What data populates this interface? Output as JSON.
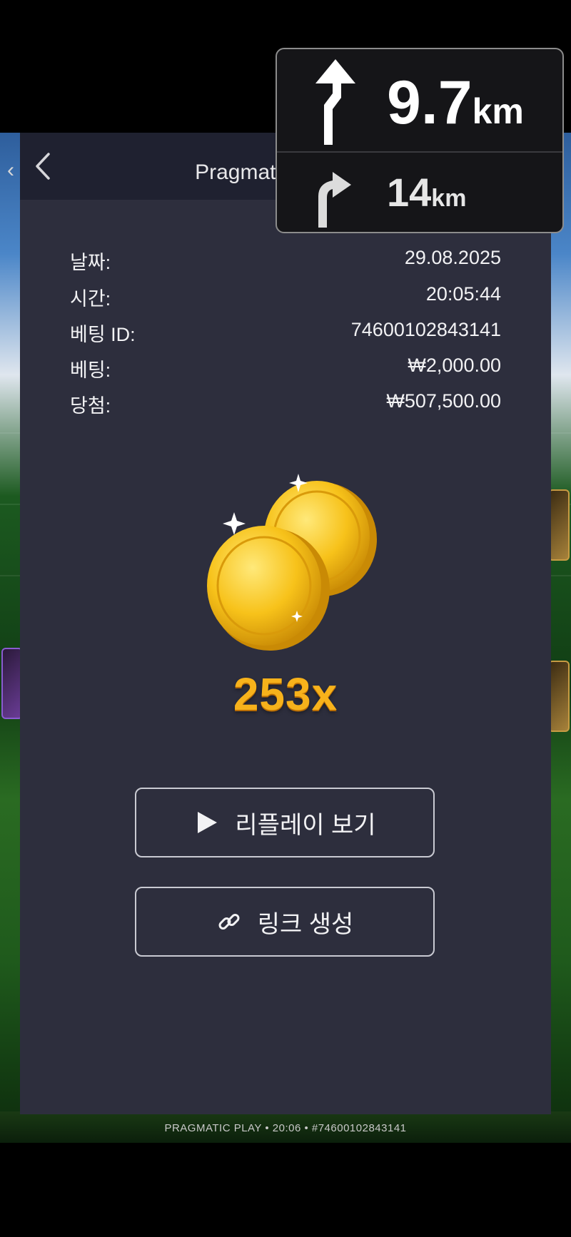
{
  "window": {
    "title": "Pragmatic 리플레이"
  },
  "details": [
    {
      "label": "날짜:",
      "value": "29.08.2025"
    },
    {
      "label": "시간:",
      "value": "20:05:44"
    },
    {
      "label": "베팅 ID:",
      "value": "74600102843141"
    },
    {
      "label": "베팅:",
      "value": "₩2,000.00"
    },
    {
      "label": "당첨:",
      "value": "₩507,500.00"
    }
  ],
  "multiplier": "253x",
  "buttons": {
    "watch_replay": "리플레이 보기",
    "create_link": "링크 생성"
  },
  "footer": "PRAGMATIC PLAY • 20:06 • #74600102843141",
  "navigation": {
    "primary_distance": "9.7",
    "primary_unit": "km",
    "secondary_distance": "14",
    "secondary_unit": "km",
    "primary_icon": "turn-left-then-straight-icon",
    "secondary_icon": "turn-right-icon"
  },
  "colors": {
    "panel": "#2d2e3d",
    "header": "#1f2130",
    "multiplier": "#f7b21b"
  }
}
